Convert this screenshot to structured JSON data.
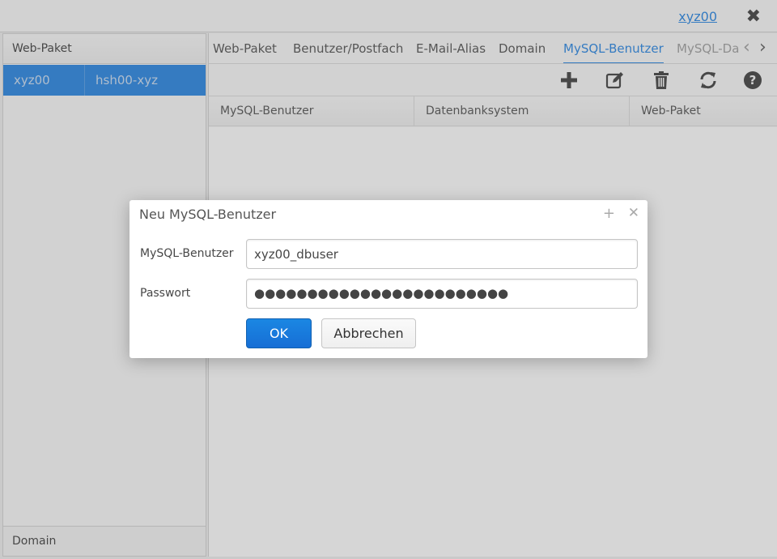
{
  "header": {
    "user_link": "xyz00",
    "close_icon": "close-icon"
  },
  "left_panel": {
    "header": "Web-Paket",
    "rows": [
      {
        "col1": "xyz00",
        "col2": "hsh00-xyz"
      }
    ],
    "footer": "Domain"
  },
  "tabs": [
    {
      "label": "Web-Paket",
      "active": false
    },
    {
      "label": "Benutzer/Postfach",
      "active": false
    },
    {
      "label": "E-Mail-Alias",
      "active": false
    },
    {
      "label": "Domain",
      "active": false
    },
    {
      "label": "MySQL-Benutzer",
      "active": true
    },
    {
      "label": "MySQL-Da",
      "active": false
    }
  ],
  "toolbar_icons": [
    "plus-icon",
    "edit-icon",
    "trash-icon",
    "refresh-icon",
    "help-icon"
  ],
  "grid": {
    "columns": [
      "MySQL-Benutzer",
      "Datenbanksystem",
      "Web-Paket"
    ]
  },
  "dialog": {
    "title": "Neu MySQL-Benutzer",
    "fields": [
      {
        "label": "MySQL-Benutzer",
        "value": "xyz00_dbuser"
      },
      {
        "label": "Passwort",
        "value": "●●●●●●●●●●●●●●●●●●●●●●●●"
      }
    ],
    "ok_label": "OK",
    "cancel_label": "Abbrechen"
  },
  "colors": {
    "accent": "#197de1",
    "selected_row": "#197de1"
  }
}
